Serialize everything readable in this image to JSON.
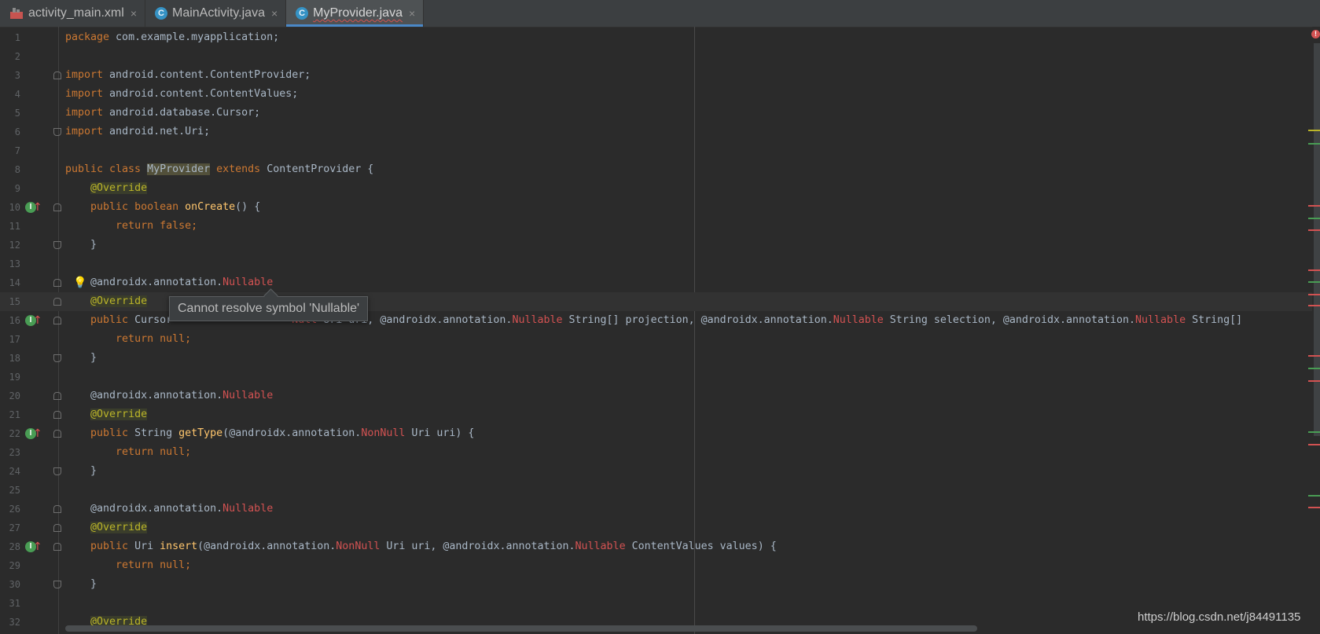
{
  "tabs": [
    {
      "label": "activity_main.xml",
      "icon": "xml-file-icon",
      "active": false
    },
    {
      "label": "MainActivity.java",
      "icon": "class-c-icon",
      "active": false
    },
    {
      "label": "MyProvider.java",
      "icon": "class-c-icon",
      "active": true
    }
  ],
  "tab_close_glyph": "×",
  "tooltip": "Cannot resolve symbol 'Nullable'",
  "watermark": "https://blog.csdn.net/j84491135",
  "error_badge": "!",
  "line_numbers": [
    "1",
    "2",
    "3",
    "4",
    "5",
    "6",
    "7",
    "8",
    "9",
    "10",
    "11",
    "12",
    "13",
    "14",
    "15",
    "16",
    "17",
    "18",
    "19",
    "20",
    "21",
    "22",
    "23",
    "24",
    "25",
    "26",
    "27",
    "28",
    "29",
    "30",
    "31",
    "32"
  ],
  "code": {
    "l1_kw": "package",
    "l1_rest": " com.example.myapplication;",
    "l3_kw": "import",
    "l3_rest": " android.content.ContentProvider;",
    "l4_kw": "import",
    "l4_rest": " android.content.ContentValues;",
    "l5_kw": "import",
    "l5_rest": " android.database.Cursor;",
    "l6_kw": "import",
    "l6_rest": " android.net.Uri;",
    "l8_kw1": "public class ",
    "l8_name": "MyProvider",
    "l8_kw2": " extends ",
    "l8_rest": "ContentProvider {",
    "override": "@Override",
    "l10_kw": "public boolean ",
    "l10_fn": "onCreate",
    "l10_rest": "() {",
    "l11_kw": "return false",
    "l11_rest": ";",
    "close_brace": "}",
    "ann_prefix": "@androidx.annotation.",
    "nullable": "Nullable",
    "nonnull": "NonNull",
    "l16_kw": "public ",
    "l16_a": "Cursor",
    "l16_b": "Null Uri uri, ",
    "l16_c": " String[] projection, ",
    "l16_d": " String selection, ",
    "l16_e": " String[]",
    "return_null_kw": "return null",
    "semicolon": ";",
    "l22_kw": "public ",
    "l22_type": "String ",
    "l22_fn": "getType",
    "l22_open": "(",
    "l22_rest": " Uri uri) {",
    "l28_kw": "public ",
    "l28_type": "Uri ",
    "l28_fn": "insert",
    "l28_open": "(",
    "l28_a": " Uri uri, ",
    "l28_b": " ContentValues values) {"
  },
  "gutter_icons": {
    "override_marker": "overrides-method-icon",
    "arrow": "↑",
    "bulb": "lightbulb-icon",
    "bulb_glyph": "💡",
    "ovr_glyph": "I"
  },
  "colors": {
    "keyword": "#cc7832",
    "annotation": "#bbb529",
    "error": "#d25252",
    "function": "#ffc66d",
    "text": "#a9b7c6",
    "background": "#2b2b2b",
    "accent": "#4a88c7"
  }
}
